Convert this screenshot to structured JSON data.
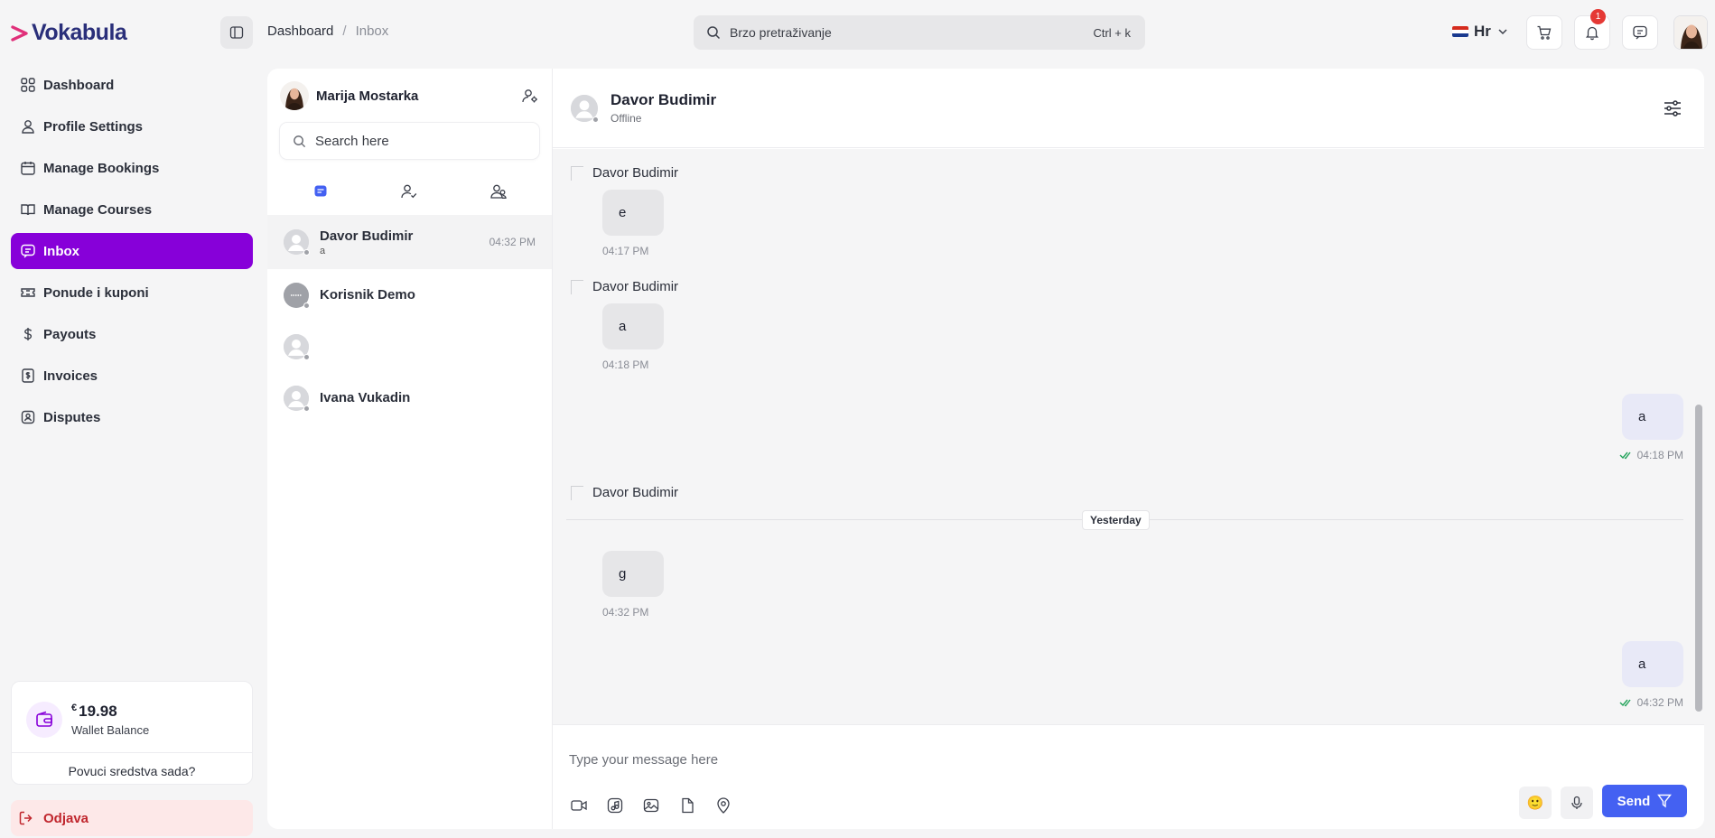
{
  "brand": {
    "name": "Vokabula",
    "accent": "#8700d9",
    "primary": "#4461f2"
  },
  "sidebar": {
    "items": [
      {
        "label": "Dashboard",
        "icon": "grid-icon"
      },
      {
        "label": "Profile Settings",
        "icon": "user-icon"
      },
      {
        "label": "Manage Bookings",
        "icon": "calendar-icon"
      },
      {
        "label": "Manage Courses",
        "icon": "book-icon"
      },
      {
        "label": "Inbox",
        "icon": "chat-icon",
        "active": true
      },
      {
        "label": "Ponude i kuponi",
        "icon": "ticket-icon"
      },
      {
        "label": "Payouts",
        "icon": "dollar-icon"
      },
      {
        "label": "Invoices",
        "icon": "invoice-icon"
      },
      {
        "label": "Disputes",
        "icon": "dispute-icon"
      }
    ],
    "wallet": {
      "currency": "€",
      "amount": "19.98",
      "label": "Wallet Balance",
      "withdraw": "Povuci sredstva sada?"
    },
    "logout": "Odjava"
  },
  "header": {
    "breadcrumb": [
      "Dashboard",
      "/",
      "Inbox"
    ],
    "search": {
      "placeholder": "Brzo pretraživanje",
      "shortcut": "Ctrl + k"
    },
    "language": "Hr",
    "notifications_count": "1"
  },
  "chatlist": {
    "user": "Marija Mostarka",
    "search_placeholder": "Search here",
    "conversations": [
      {
        "name": "Davor Budimir",
        "preview": "a",
        "time": "04:32 PM",
        "active": true
      },
      {
        "name": "Korisnik Demo",
        "preview": "",
        "time": ""
      },
      {
        "name": "",
        "preview": "",
        "time": ""
      },
      {
        "name": "Ivana Vukadin",
        "preview": "",
        "time": ""
      }
    ]
  },
  "chat": {
    "name": "Davor Budimir",
    "status": "Offline",
    "messages": {
      "m1": {
        "sender": "Davor Budimir",
        "text": "e",
        "time": "04:17 PM"
      },
      "m2": {
        "sender": "Davor Budimir",
        "text": "a",
        "time": "04:18 PM"
      },
      "m3": {
        "text": "a",
        "time": "04:18 PM"
      },
      "m4": {
        "sender": "Davor Budimir"
      },
      "day": "Yesterday",
      "m5": {
        "text": "g",
        "time": "04:32 PM"
      },
      "m6": {
        "text": "a",
        "time": "04:32 PM"
      }
    },
    "composer": {
      "placeholder": "Type your message here",
      "send": "Send",
      "emoji": "🙂"
    }
  }
}
